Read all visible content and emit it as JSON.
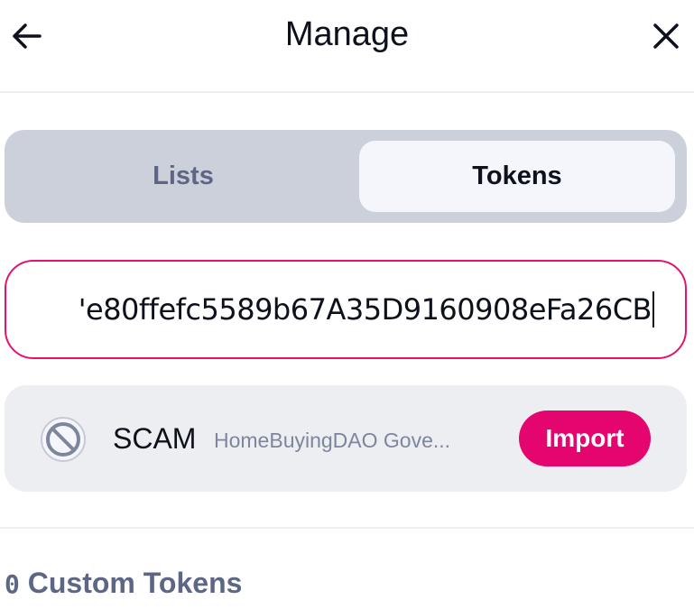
{
  "header": {
    "title": "Manage",
    "back_icon": "arrow-left-icon",
    "close_icon": "close-icon"
  },
  "tabs": [
    {
      "label": "Lists",
      "selected": false
    },
    {
      "label": "Tokens",
      "selected": true
    }
  ],
  "search": {
    "value": "'e80ffefc5589b67A35D9160908eFa26CB"
  },
  "token_result": {
    "icon": "blocked-icon",
    "symbol": "SCAM",
    "name": "HomeBuyingDAO Gove...",
    "import_label": "Import"
  },
  "custom_tokens": {
    "count": "0",
    "label": " Custom Tokens"
  },
  "colors": {
    "accent": "#e4056f",
    "tab_bar": "#ccd0db",
    "card": "#edeef2",
    "text_secondary": "#5d6785"
  }
}
